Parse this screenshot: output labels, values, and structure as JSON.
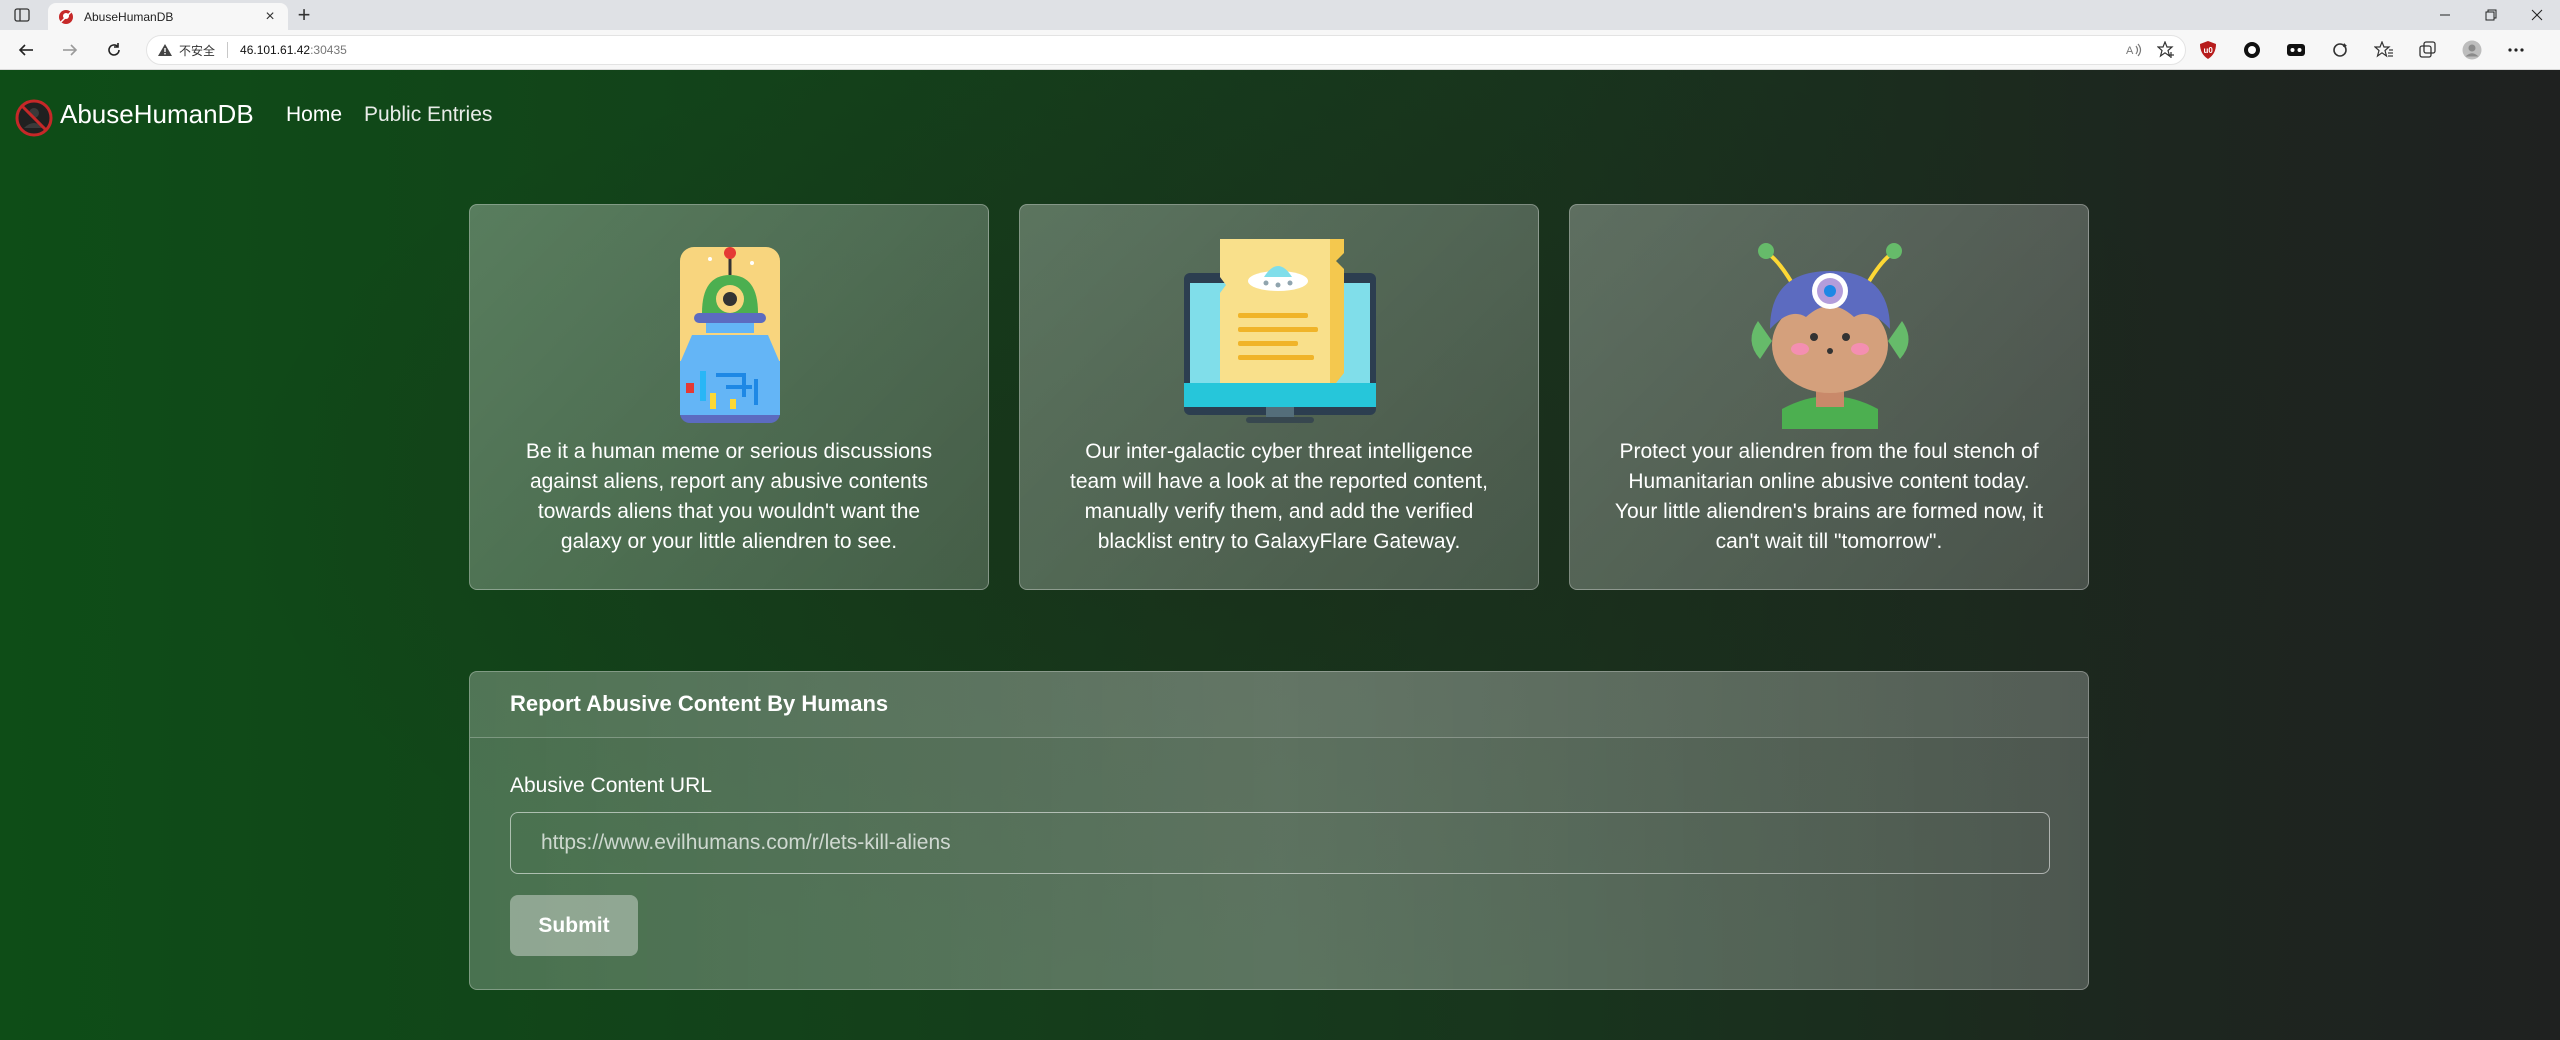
{
  "browser": {
    "tab_title": "AbuseHumanDB",
    "insecure_label": "不安全",
    "url_host": "46.101.61.42",
    "url_port": ":30435"
  },
  "nav": {
    "brand": "AbuseHumanDB",
    "links": [
      "Home",
      "Public Entries"
    ]
  },
  "cards": [
    {
      "illustration": "alien-robot-icon",
      "text": "Be it a human meme or serious discussions against aliens, report any abusive contents towards aliens that you wouldn't want the galaxy or your little aliendren to see."
    },
    {
      "illustration": "monitor-document-icon",
      "text": "Our inter-galactic cyber threat intelligence team will have a look at the reported content, manually verify them, and add the verified blacklist entry to GalaxyFlare Gateway."
    },
    {
      "illustration": "alien-child-icon",
      "text": "Protect your aliendren from the foul stench of Humanitarian online abusive content today. Your little aliendren's brains are formed now, it can't wait till \"tomorrow\"."
    }
  ],
  "report_form": {
    "title": "Report Abusive Content By Humans",
    "field_label": "Abusive Content URL",
    "placeholder": "https://www.evilhumans.com/r/lets-kill-aliens",
    "submit_label": "Submit"
  },
  "colors": {
    "page_gradient_start": "#0e4d17",
    "page_gradient_end": "#1f2120",
    "favicon_red": "#c62828"
  }
}
